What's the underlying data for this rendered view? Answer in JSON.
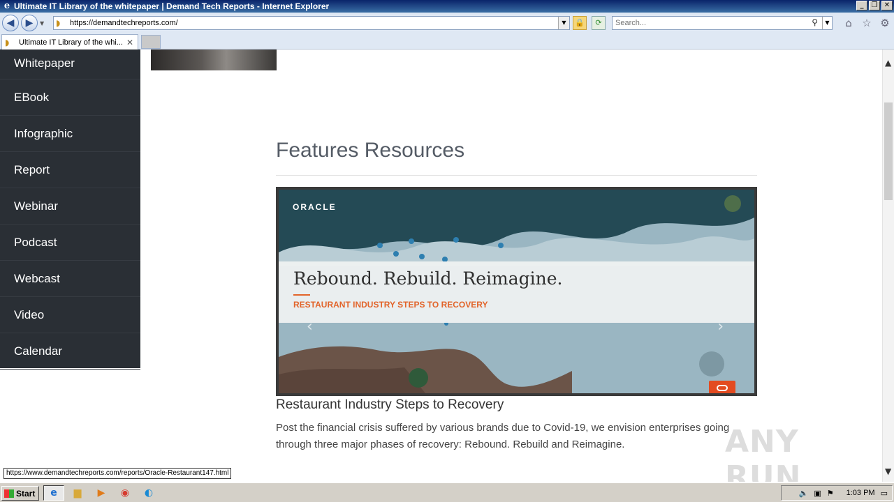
{
  "window": {
    "title": "Ultimate IT Library of the whitepaper | Demand Tech Reports - Internet Explorer",
    "controls": [
      "_",
      "❐",
      "✕"
    ]
  },
  "address_bar": {
    "url": "https://demandtechreports.com/",
    "search_placeholder": "Search..."
  },
  "tab": {
    "label": "Ultimate IT Library of the whi...",
    "close": "✕"
  },
  "sidebar": {
    "items": [
      {
        "label": "Whitepaper"
      },
      {
        "label": "EBook"
      },
      {
        "label": "Infographic"
      },
      {
        "label": "Report"
      },
      {
        "label": "Webinar"
      },
      {
        "label": "Podcast"
      },
      {
        "label": "Webcast"
      },
      {
        "label": "Video"
      },
      {
        "label": "Calendar"
      }
    ]
  },
  "main": {
    "section_heading": "Features Resources",
    "banner": {
      "brand": "ORACLE",
      "headline": "Rebound. Rebuild. Reimagine.",
      "subheadline": "RESTAURANT INDUSTRY STEPS TO RECOVERY",
      "prev": "‹",
      "next": "›"
    },
    "resource_title": "Restaurant Industry Steps to Recovery",
    "resource_description": "Post the financial crisis suffered by various brands due to Covid-19, we envision enterprises going through three major phases of recovery: Rebound. Rebuild and Reimagine."
  },
  "watermark": "ANY RUN",
  "status_bar": {
    "hover_url": "https://www.demandtechreports.com/reports/Oracle-Restaurant147.html"
  },
  "taskbar": {
    "start_label": "Start",
    "clock": "1:03 PM"
  },
  "colors": {
    "sidebar_bg": "#2a2f35",
    "accent_orange": "#e2642a",
    "heading_gray": "#555c66"
  }
}
